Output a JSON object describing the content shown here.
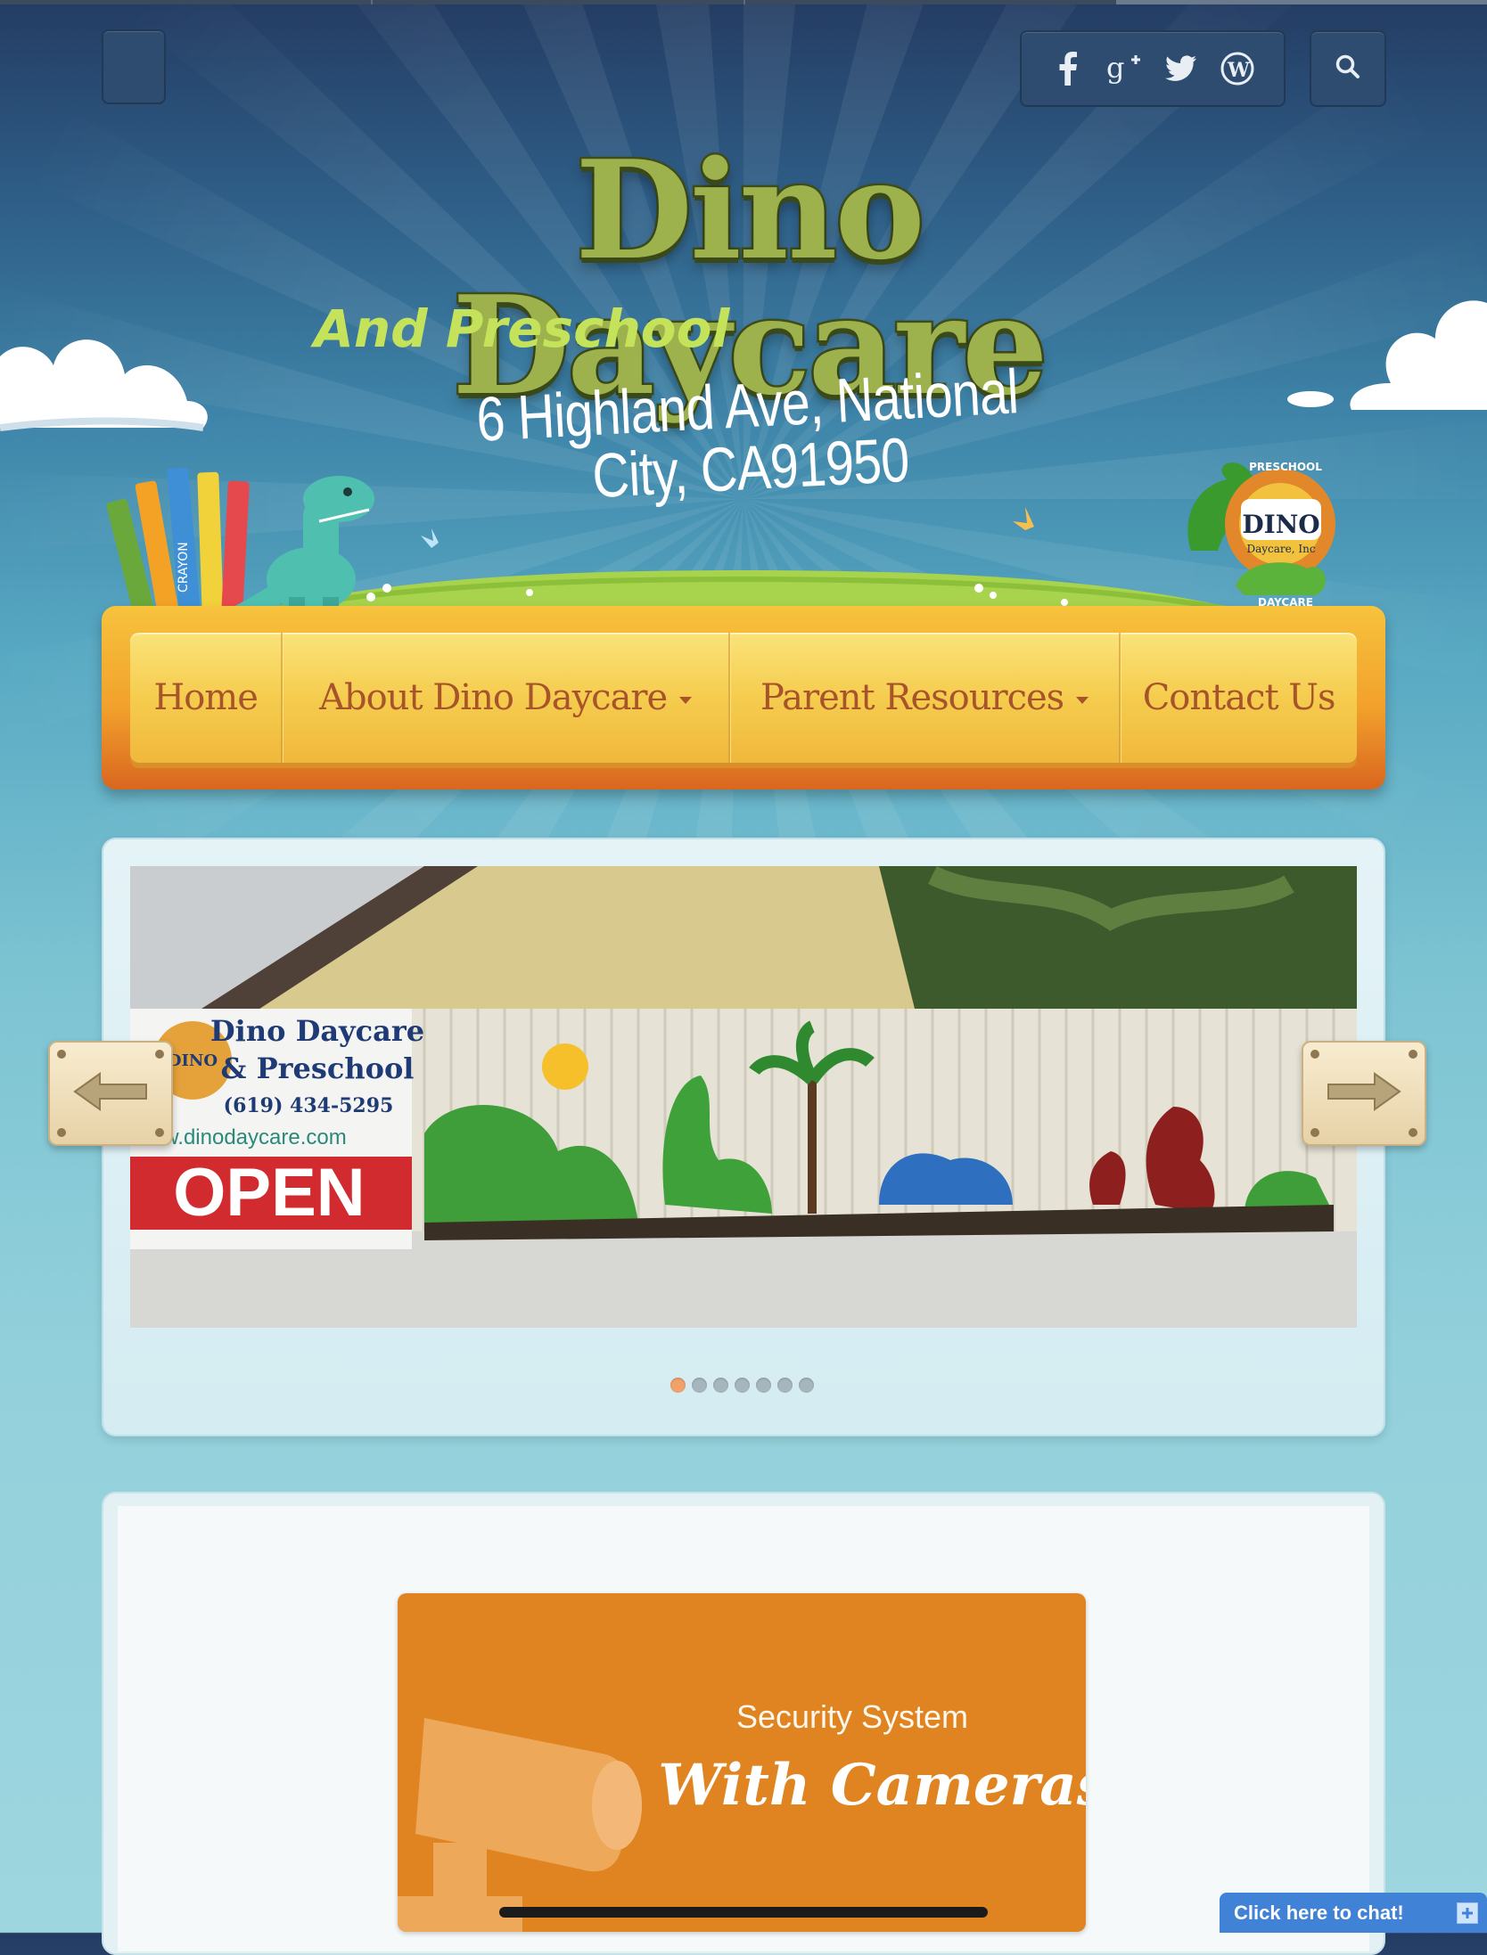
{
  "header": {
    "social_icons": [
      "facebook-icon",
      "google-plus-icon",
      "twitter-icon",
      "wordpress-icon"
    ],
    "search_icon": "search-icon",
    "site_title": "Dino Daycare",
    "site_subtitle": "And Preschool",
    "address": "6 Highland Ave, National City, CA91950",
    "badge": {
      "top": "PRESCHOOL",
      "main": "DINO",
      "sub": "Daycare, Inc",
      "bottom": "DAYCARE"
    },
    "crayon_label": "CRAYON"
  },
  "nav": {
    "items": [
      {
        "label": "Home",
        "dropdown": false
      },
      {
        "label": "About Dino Daycare",
        "dropdown": true
      },
      {
        "label": "Parent Resources",
        "dropdown": true
      },
      {
        "label": "Contact Us",
        "dropdown": false
      }
    ]
  },
  "slider": {
    "slide": {
      "banner_line1": "Dino Daycare",
      "banner_line2": "& Preschool",
      "banner_phone": "(619) 434-5295",
      "banner_url": "w.dinodaycare.com",
      "banner_open": "OPEN",
      "banner_badge": "DINO"
    },
    "dot_count": 7,
    "active_dot": 1
  },
  "feature": {
    "line1": "Security System",
    "line2": "With Cameras"
  },
  "chat": {
    "label": "Click here to chat!"
  },
  "colors": {
    "nav_text": "#a7542a",
    "feature_bg": "#e08421",
    "chat_bg": "#3f82d6",
    "title_green": "#9db24d"
  }
}
